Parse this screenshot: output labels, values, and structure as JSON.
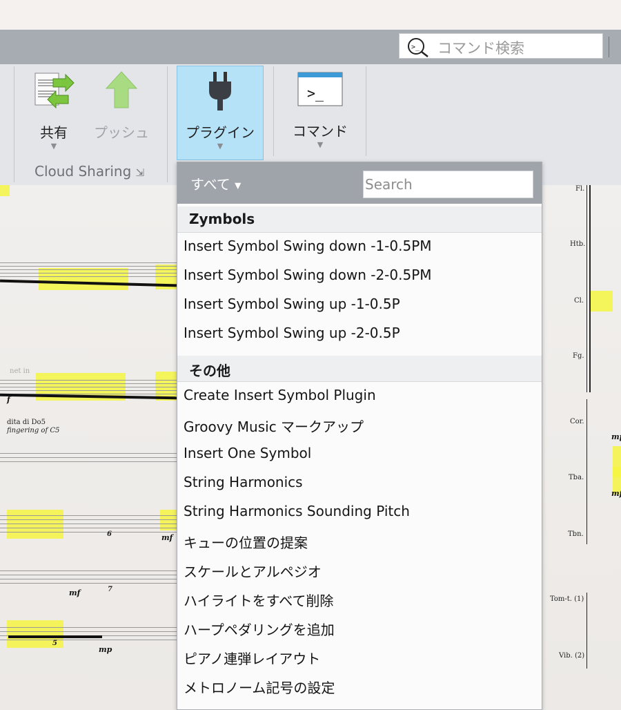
{
  "command_search": {
    "placeholder": "コマンド検索"
  },
  "ribbon": {
    "share_label": "共有",
    "push_label": "プッシュ",
    "plugins_label": "プラグイン",
    "commands_label": "コマンド",
    "group_label": "Cloud Sharing"
  },
  "plugins_menu": {
    "filter_label": "すべて",
    "search_placeholder": "Search",
    "sections": [
      {
        "title": "Zymbols",
        "items": [
          "Insert Symbol Swing down -1-0.5PM",
          "Insert Symbol Swing down -2-0.5PM",
          "Insert Symbol Swing up -1-0.5P",
          "Insert Symbol Swing up -2-0.5P"
        ]
      },
      {
        "title": "その他",
        "items": [
          "Create Insert Symbol Plugin",
          "Groovy Music マークアップ",
          "Insert One Symbol",
          "String Harmonics",
          "String Harmonics Sounding Pitch",
          "キューの位置の提案",
          "スケールとアルペジオ",
          "ハイライトをすべて削除",
          "ハープペダリングを追加",
          "ピアノ連弾レイアウト",
          "メトロノーム記号の設定"
        ]
      }
    ]
  },
  "score": {
    "instruments": [
      "Fl.",
      "Htb.",
      "Cl.",
      "Fg.",
      "Cor.",
      "Tba.",
      "Tbn.",
      "Tom-t. (1)",
      "Vib. (2)"
    ],
    "annotations": {
      "dita": "dita di Do5",
      "fingering": "fingering of C5",
      "faded": "net in"
    },
    "dynamics": {
      "f": "f",
      "mf": "mf",
      "mp": "mp"
    },
    "tuplets": {
      "six": "6",
      "seven": "7",
      "five": "5"
    }
  },
  "colors": {
    "highlight": "#f4f442",
    "plugins_active": "#b6e2f8",
    "popup_header": "#9fa4ab",
    "command_bar": "#a7acb3"
  }
}
